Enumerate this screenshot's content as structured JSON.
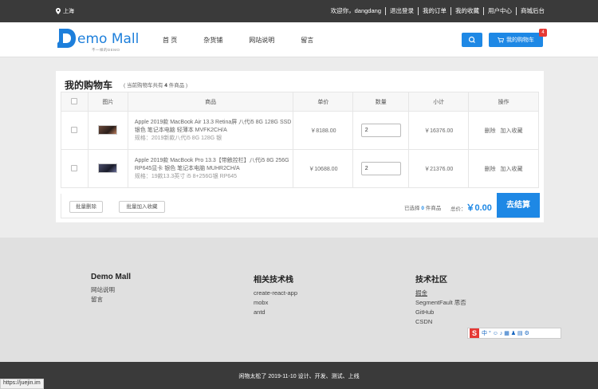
{
  "topbar": {
    "location": "上海",
    "links": [
      "欢迎你，dangdang",
      "退出登录",
      "我的订单",
      "我的收藏",
      "用户中心",
      "商城后台"
    ]
  },
  "header": {
    "logo_text": "emo Mall",
    "logo_sub": "不一样的DEMO",
    "nav": [
      "首 页",
      "杂货铺",
      "网站说明",
      "留言"
    ],
    "cart_label": "我的购物车",
    "cart_count": "4",
    "brand_color": "#1e88e5"
  },
  "cart": {
    "title": "我的购物车",
    "subtitle_prefix": "( 当前购物车共有",
    "subtitle_count": "4",
    "subtitle_suffix": "件商品 )",
    "columns": [
      "图片",
      "商品",
      "单价",
      "数量",
      "小计",
      "操作"
    ],
    "rows": [
      {
        "name": "Apple 2019款 MacBook Air 13.3 Retina屏 八代i5 8G 128G SSD 银色 笔记本电脑 轻薄本 MVFK2CH/A",
        "spec": "规格：2019新款八代i5 8G 128G 银",
        "price": "￥8188.00",
        "qty": "2",
        "subtotal": "￥16376.00",
        "op_delete": "删除",
        "op_fav": "加入收藏"
      },
      {
        "name": "Apple 2019款 MacBook Pro 13.3【带触控栏】八代i5 8G 256G RP645显卡 银色 笔记本电脑 MUHR2CH/A",
        "spec": "规格：19款13.3英寸 i5 8+256G银 RP645",
        "price": "￥10688.00",
        "qty": "2",
        "subtotal": "￥21376.00",
        "op_delete": "删除",
        "op_fav": "加入收藏"
      }
    ],
    "batch_delete": "批量删除",
    "batch_fav": "批量加入收藏",
    "selected_prefix": "已选择",
    "selected_count": "0",
    "selected_suffix": "件商品",
    "total_label": "总价：",
    "total_value": "￥0.00",
    "checkout": "去结算"
  },
  "footer": {
    "col1": {
      "title": "Demo Mall",
      "items": [
        "网站说明",
        "留言"
      ]
    },
    "col2": {
      "title": "相关技术栈",
      "items": [
        "create-react-app",
        "mobx",
        "antd"
      ]
    },
    "col3": {
      "title": "技术社区",
      "items": [
        "掘金",
        "SegmentFault 思否",
        "GitHub",
        "CSDN"
      ]
    },
    "ime_text": "中 ° ☺ ♪ ▦ ♟ ▤ ⚙",
    "copyright": "闲物太松了 2019-11-10 设计、开发、测试、上线",
    "status_url": "https://juejin.im"
  }
}
